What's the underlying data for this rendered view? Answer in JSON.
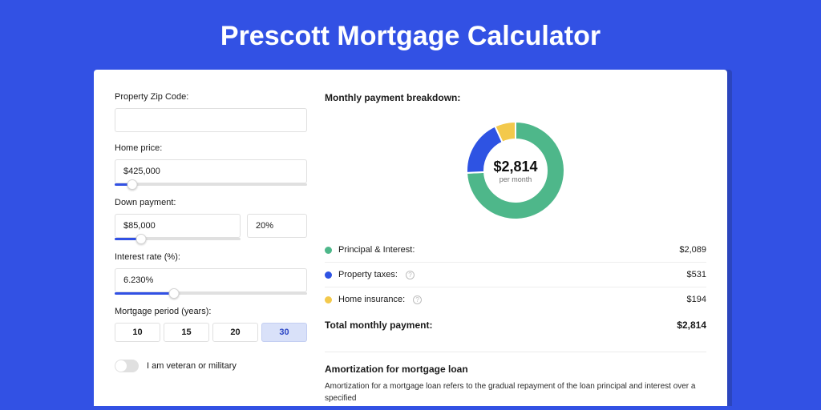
{
  "page_title": "Prescott Mortgage Calculator",
  "form": {
    "zip": {
      "label": "Property Zip Code:",
      "value": ""
    },
    "home_price": {
      "label": "Home price:",
      "value": "$425,000",
      "slider_pct": 9
    },
    "down_payment": {
      "label": "Down payment:",
      "amount": "$85,000",
      "percent": "20%",
      "slider_pct": 21
    },
    "interest_rate": {
      "label": "Interest rate (%):",
      "value": "6.230%",
      "slider_pct": 31
    },
    "mortgage_period": {
      "label": "Mortgage period (years):",
      "options": [
        "10",
        "15",
        "20",
        "30"
      ],
      "selected": 3
    },
    "veteran": {
      "label": "I am veteran or military",
      "checked": false
    }
  },
  "breakdown": {
    "title": "Monthly payment breakdown:",
    "center_amount": "$2,814",
    "center_sub": "per month",
    "items": [
      {
        "label": "Principal & Interest:",
        "amount": "$2,089",
        "color": "#4eb78a",
        "info": false
      },
      {
        "label": "Property taxes:",
        "amount": "$531",
        "color": "#2e53e3",
        "info": true
      },
      {
        "label": "Home insurance:",
        "amount": "$194",
        "color": "#f3c94c",
        "info": true
      }
    ],
    "total_label": "Total monthly payment:",
    "total_amount": "$2,814"
  },
  "amortization": {
    "title": "Amortization for mortgage loan",
    "body": "Amortization for a mortgage loan refers to the gradual repayment of the loan principal and interest over a specified"
  },
  "chart_data": {
    "type": "pie",
    "title": "Monthly payment breakdown",
    "series": [
      {
        "name": "Principal & Interest",
        "value": 2089,
        "color": "#4eb78a"
      },
      {
        "name": "Property taxes",
        "value": 531,
        "color": "#2e53e3"
      },
      {
        "name": "Home insurance",
        "value": 194,
        "color": "#f3c94c"
      }
    ],
    "total": 2814
  }
}
